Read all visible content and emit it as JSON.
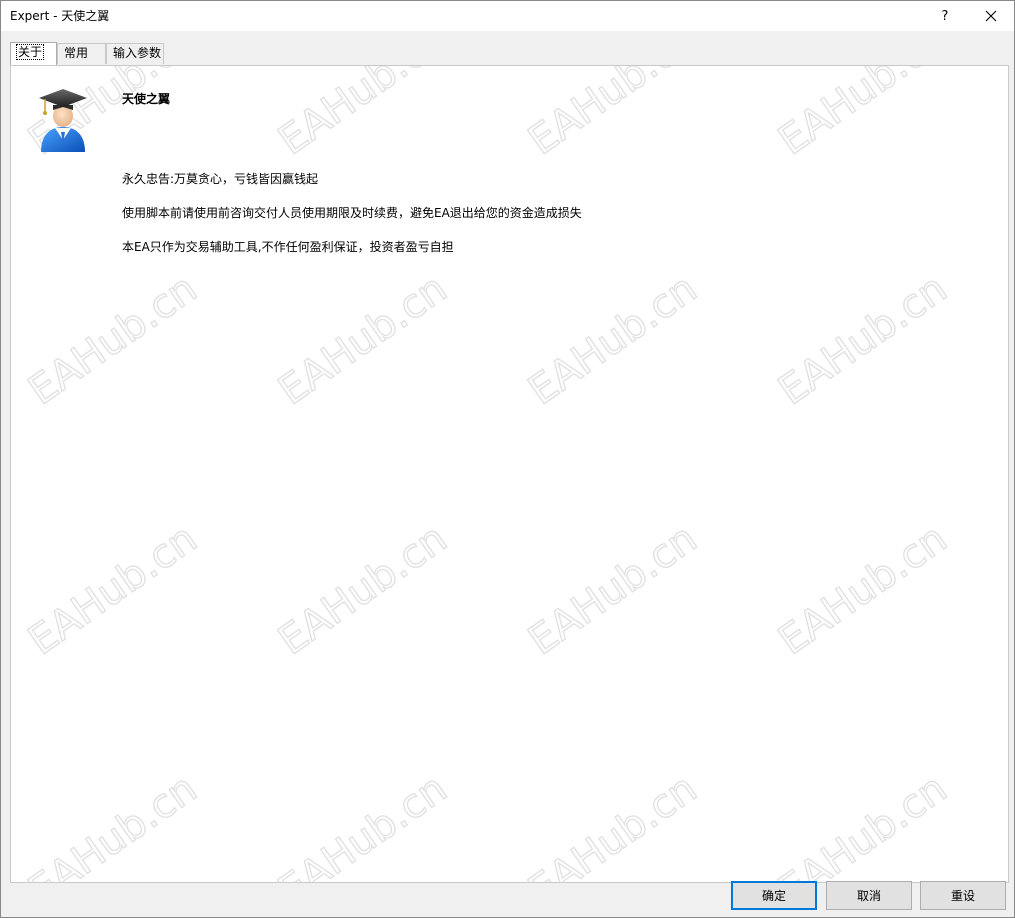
{
  "window": {
    "title": "Expert - 天使之翼",
    "help_label": "?",
    "close_icon": "close-icon"
  },
  "tabs": [
    {
      "label": "关于",
      "active": true
    },
    {
      "label": "常用",
      "active": false
    },
    {
      "label": "输入参数",
      "active": false
    }
  ],
  "about": {
    "icon": "graduate-user-icon",
    "name": "天使之翼",
    "lines": [
      "永久忠告:万莫贪心，亏钱皆因赢钱起",
      "使用脚本前请使用前咨询交付人员使用期限及时续费，避免EA退出给您的资金造成损失",
      "本EA只作为交易辅助工具,不作任何盈利保证，投资者盈亏自担"
    ]
  },
  "watermark": "EAHub.cn",
  "buttons": {
    "ok": "确定",
    "cancel": "取消",
    "reset": "重设"
  },
  "colors": {
    "accent": "#0078d7",
    "panel_bg": "#ffffff",
    "dialog_bg": "#f0f0f0"
  }
}
